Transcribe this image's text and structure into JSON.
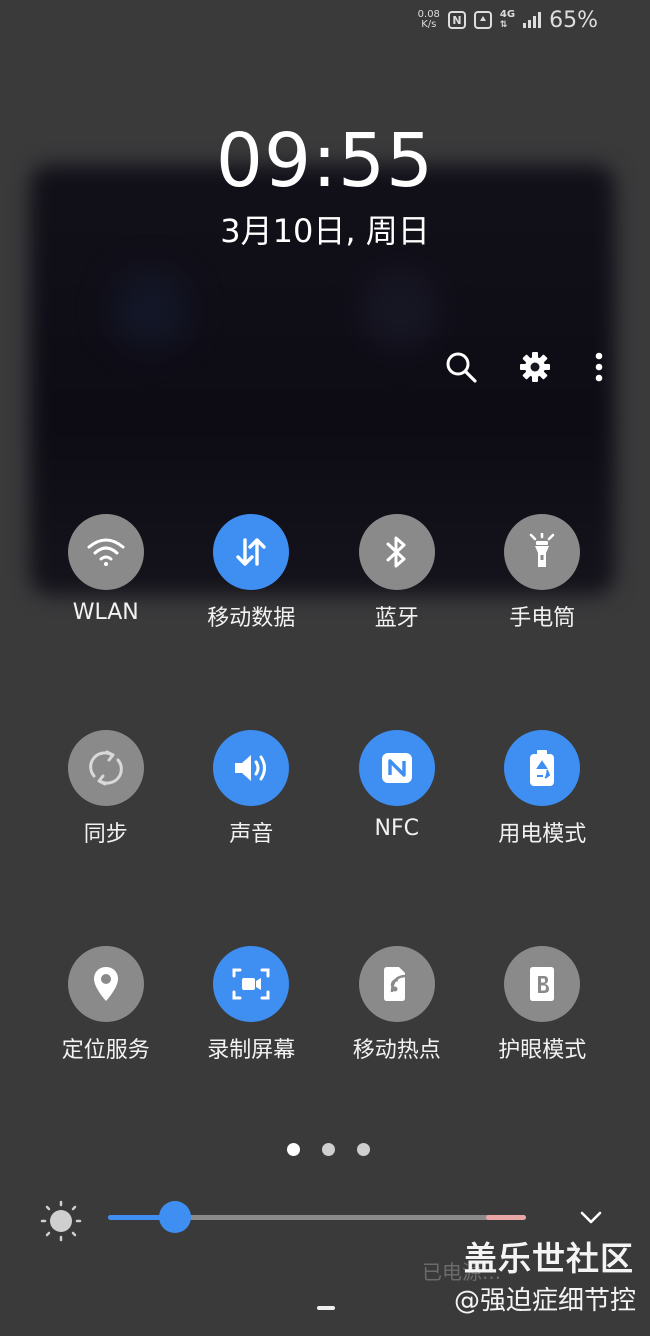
{
  "status_bar": {
    "speed_value": "0.08",
    "speed_unit": "K/s",
    "nfc_badge": "N",
    "network": "4G",
    "battery": "65%"
  },
  "lockscreen": {
    "time": "09:55",
    "date": "3月10日, 周日"
  },
  "header_icons": [
    "search-icon",
    "gear-icon",
    "more-vert-icon"
  ],
  "quick_settings": [
    {
      "label": "WLAN",
      "icon": "wifi-icon",
      "on": false
    },
    {
      "label": "移动数据",
      "icon": "mobile-data-icon",
      "on": true
    },
    {
      "label": "蓝牙",
      "icon": "bluetooth-icon",
      "on": false
    },
    {
      "label": "手电筒",
      "icon": "flashlight-icon",
      "on": false
    },
    {
      "label": "同步",
      "icon": "sync-icon",
      "on": false
    },
    {
      "label": "声音",
      "icon": "sound-icon",
      "on": true
    },
    {
      "label": "NFC",
      "icon": "nfc-icon",
      "on": true
    },
    {
      "label": "用电模式",
      "icon": "power-mode-icon",
      "on": true
    },
    {
      "label": "定位服务",
      "icon": "location-icon",
      "on": false
    },
    {
      "label": "录制屏幕",
      "icon": "screen-record-icon",
      "on": true
    },
    {
      "label": "移动热点",
      "icon": "hotspot-icon",
      "on": false
    },
    {
      "label": "护眼模式",
      "icon": "eye-comfort-icon",
      "on": false
    }
  ],
  "page_dots": {
    "count": 3,
    "active": 0
  },
  "brightness": {
    "level": 0.16
  },
  "watermark": {
    "title": "盖乐世社区",
    "author": "@强迫症细节控",
    "faint_text": "已电源..."
  },
  "colors": {
    "accent": "#3f8ff2",
    "tile_off": "#8a8a8a",
    "background": "#3a3a3b"
  }
}
